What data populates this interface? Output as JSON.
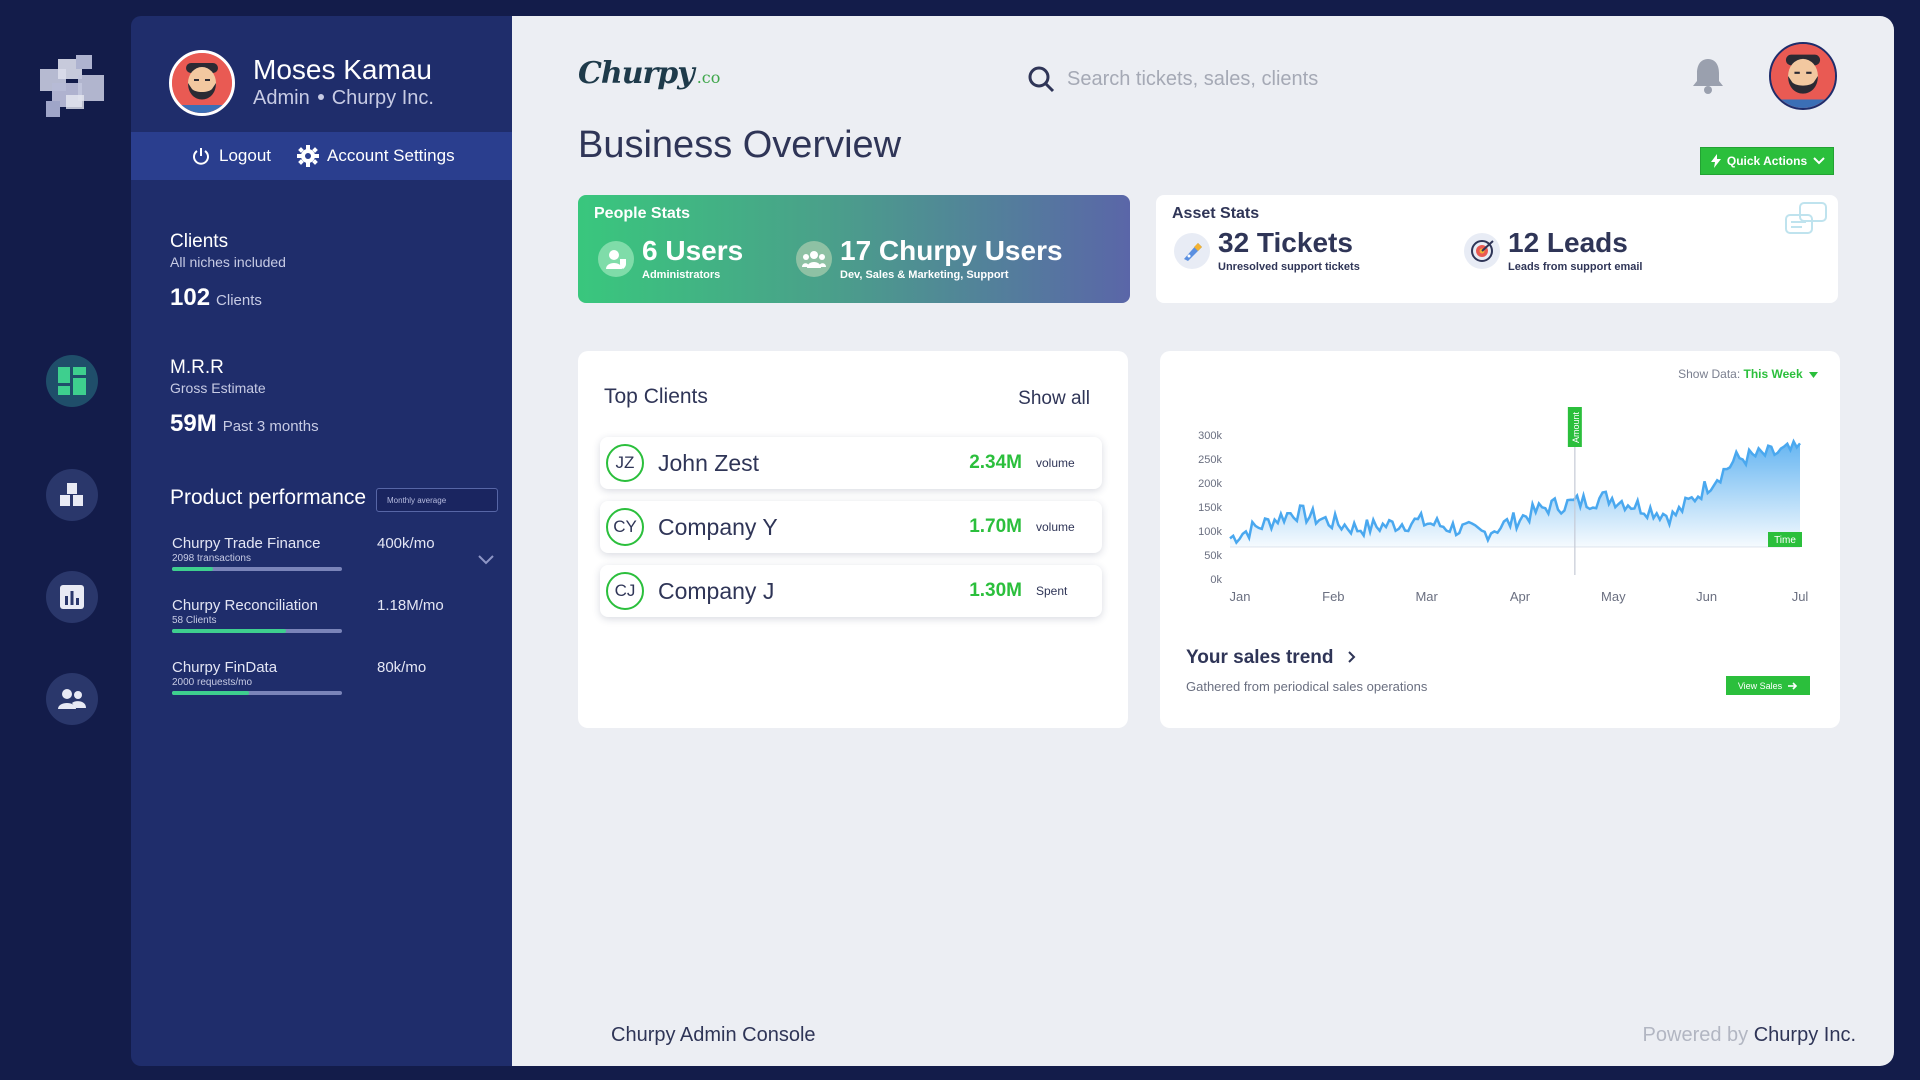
{
  "profile": {
    "name": "Moses Kamau",
    "role": "Admin",
    "company": "Churpy Inc."
  },
  "account": {
    "logout": "Logout",
    "settings": "Account Settings"
  },
  "clients_stat": {
    "title": "Clients",
    "subtitle": "All niches included",
    "value": "102",
    "unit": "Clients"
  },
  "mrr_stat": {
    "title": "M.R.R",
    "subtitle": "Gross Estimate",
    "value": "59M",
    "unit": "Past 3 months"
  },
  "performance": {
    "title": "Product performance",
    "select": "Monthly average",
    "items": [
      {
        "name": "Churpy Trade Finance",
        "meta": "2098 transactions",
        "value": "400k/mo",
        "progress": 0.24
      },
      {
        "name": "Churpy Reconciliation",
        "meta": "58 Clients",
        "value": "1.18M/mo",
        "progress": 0.67
      },
      {
        "name": "Churpy FinData",
        "meta": "2000 requests/mo",
        "value": "80k/mo",
        "progress": 0.45
      }
    ]
  },
  "brand": {
    "name": "Churpy",
    "suffix": ".co"
  },
  "search": {
    "placeholder": "Search tickets, sales, clients"
  },
  "page": {
    "title": "Business Overview",
    "quick_actions": "Quick Actions"
  },
  "people_stats": {
    "label": "People Stats",
    "users": {
      "value": "6 Users",
      "caption": "Administrators"
    },
    "churpy_users": {
      "value": "17 Churpy Users",
      "caption": "Dev, Sales & Marketing, Support"
    }
  },
  "asset_stats": {
    "label": "Asset Stats",
    "tickets": {
      "value": "32 Tickets",
      "caption": "Unresolved support tickets"
    },
    "leads": {
      "value": "12 Leads",
      "caption": "Leads from support email"
    }
  },
  "top_clients": {
    "title": "Top Clients",
    "show_all": "Show all",
    "rows": [
      {
        "initials": "JZ",
        "name": "John Zest",
        "amount": "2.34M",
        "kind": "volume"
      },
      {
        "initials": "CY",
        "name": "Company Y",
        "amount": "1.70M",
        "kind": "volume"
      },
      {
        "initials": "CJ",
        "name": "Company J",
        "amount": "1.30M",
        "kind": "Spent"
      }
    ]
  },
  "sales": {
    "show_data_label": "Show Data:",
    "period": "This Week",
    "trend_title": "Your sales trend",
    "trend_sub": "Gathered from periodical sales operations",
    "view_sales": "View Sales",
    "amount_tag": "Amount",
    "time_tag": "Time"
  },
  "chart_data": {
    "type": "area",
    "x": [
      "Jan",
      "Feb",
      "Mar",
      "Apr",
      "May",
      "Jun",
      "Jul"
    ],
    "values": [
      85,
      140,
      105,
      120,
      95,
      150,
      170,
      130,
      250,
      270
    ],
    "ylim": [
      0,
      300
    ],
    "yticks": [
      "300k",
      "250k",
      "200k",
      "150k",
      "100k",
      "50k",
      "0k"
    ],
    "color": "#4aa8ef",
    "grid": false
  },
  "footer": {
    "left": "Churpy Admin Console",
    "powered": "Powered by",
    "company": "Churpy Inc."
  },
  "colors": {
    "accent": "#2bbf3c",
    "sidebar": "#1f2d6b",
    "background": "#131c4a"
  }
}
